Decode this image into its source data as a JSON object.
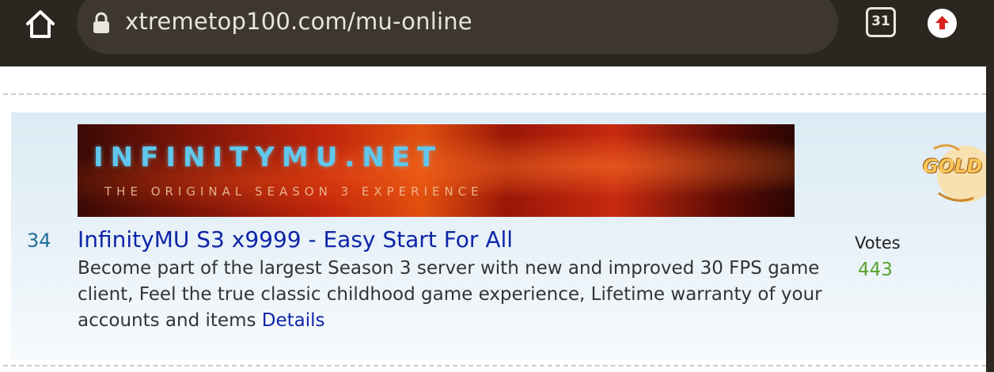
{
  "browser": {
    "url": "xtremetop100.com/mu-online",
    "tab_count": "31",
    "colors": {
      "bar": "#2b2620",
      "urlbar": "#3d3730",
      "update_badge": "#d9201f"
    }
  },
  "listing": {
    "rank": "34",
    "title": "InfinityMU S3 x9999 - Easy Start For All",
    "description": "Become part of the largest Season 3 server with new and improved 30 FPS game client, Feel the true classic childhood game experience, Lifetime warranty of your accounts and items",
    "details_label": "Details",
    "votes_label": "Votes",
    "votes_count": "443",
    "banner": {
      "title": "INFINITYMU.NET",
      "subtitle": "THE ORIGINAL SEASON 3 EXPERIENCE"
    },
    "side_badge": "GOLD",
    "colors": {
      "title": "#0e25a8",
      "rank": "#1f6f9c",
      "votes": "#5aa02c"
    }
  }
}
